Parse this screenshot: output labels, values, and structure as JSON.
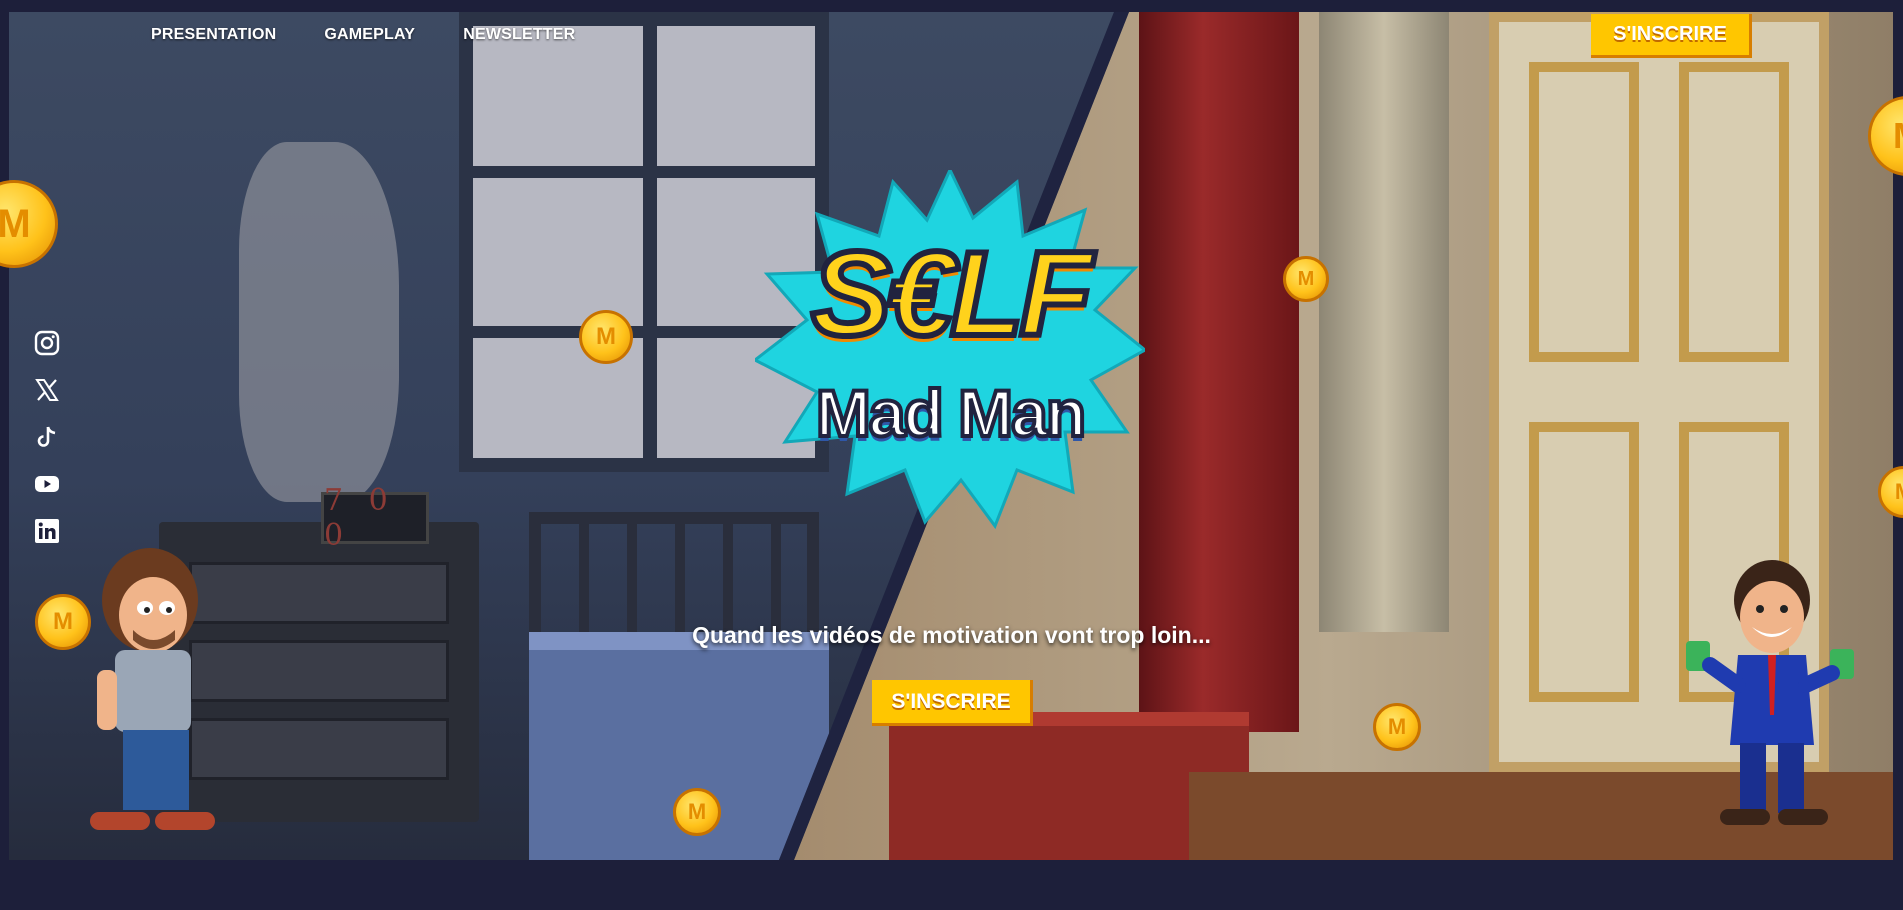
{
  "nav": {
    "items": [
      {
        "label": "PRESENTATION"
      },
      {
        "label": "GAMEPLAY"
      },
      {
        "label": "NEWSLETTER"
      }
    ],
    "cta_label": "S'INSCRIRE"
  },
  "social": {
    "icons": [
      "instagram-icon",
      "x-twitter-icon",
      "tiktok-icon",
      "youtube-icon",
      "linkedin-icon"
    ]
  },
  "hero": {
    "logo_line1": "S€LF",
    "logo_line2": "Mad Man",
    "clock_text": "7 0 0",
    "tagline": "Quand les vidéos de motivation vont trop loin...",
    "cta_label": "S'INSCRIRE",
    "coin_symbol": "M"
  },
  "colors": {
    "page_background": "#1d1f3a",
    "accent_yellow": "#ffc600",
    "accent_shadow": "#d77e00",
    "burst_cyan": "#1fd4e0",
    "text_white": "#ffffff"
  }
}
